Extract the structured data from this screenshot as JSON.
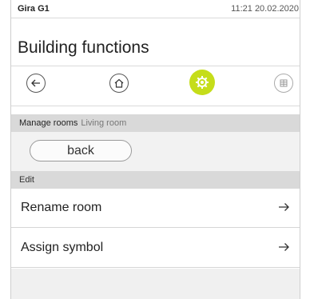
{
  "statusbar": {
    "device": "Gira G1",
    "clock": "11:21 20.02.2020"
  },
  "header": {
    "title": "Building functions"
  },
  "nav": {
    "back": "back-arrow-icon",
    "home": "home-icon",
    "settings": "gear-icon",
    "grid": "grid-icon",
    "active_color": "#c5dd1a"
  },
  "manage": {
    "heading": "Manage rooms",
    "room": "Living room",
    "back_label": "back"
  },
  "edit": {
    "heading": "Edit",
    "items": [
      {
        "label": "Rename room"
      },
      {
        "label": "Assign symbol"
      }
    ]
  }
}
